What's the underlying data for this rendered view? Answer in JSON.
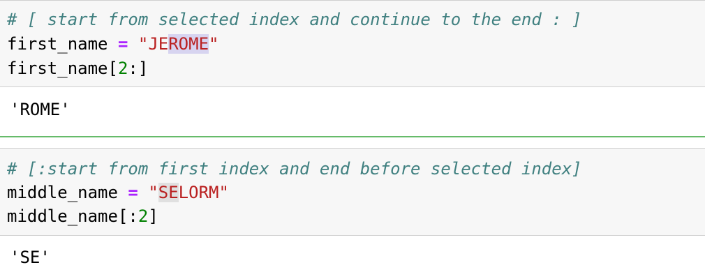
{
  "cell1": {
    "comment": "# [ start from selected index and continue to the end : ]",
    "assign_var": "first_name",
    "assign_op": "=",
    "string_quote_open": "\"",
    "string_prefix": "JE",
    "string_highlight": "ROME",
    "string_quote_close": "\"",
    "slice_var": "first_name",
    "slice_open": "[",
    "slice_start": "2",
    "slice_rest": ":]",
    "output": "'ROME'"
  },
  "cell2": {
    "comment": "# [:start from first index and end before selected index]",
    "assign_var": "middle_name",
    "assign_op": "=",
    "string_quote_open": "\"",
    "string_highlight": "SE",
    "string_suffix": "LORM",
    "string_quote_close": "\"",
    "slice_var": "middle_name",
    "slice_open": "[:",
    "slice_end": "2",
    "slice_close": "]",
    "output": "'SE'"
  },
  "colors": {
    "comment": "#408080",
    "operator": "#aa22ff",
    "string": "#ba2121",
    "number": "#008000",
    "separator": "#66bb6a",
    "cell_background": "#f7f7f7"
  }
}
